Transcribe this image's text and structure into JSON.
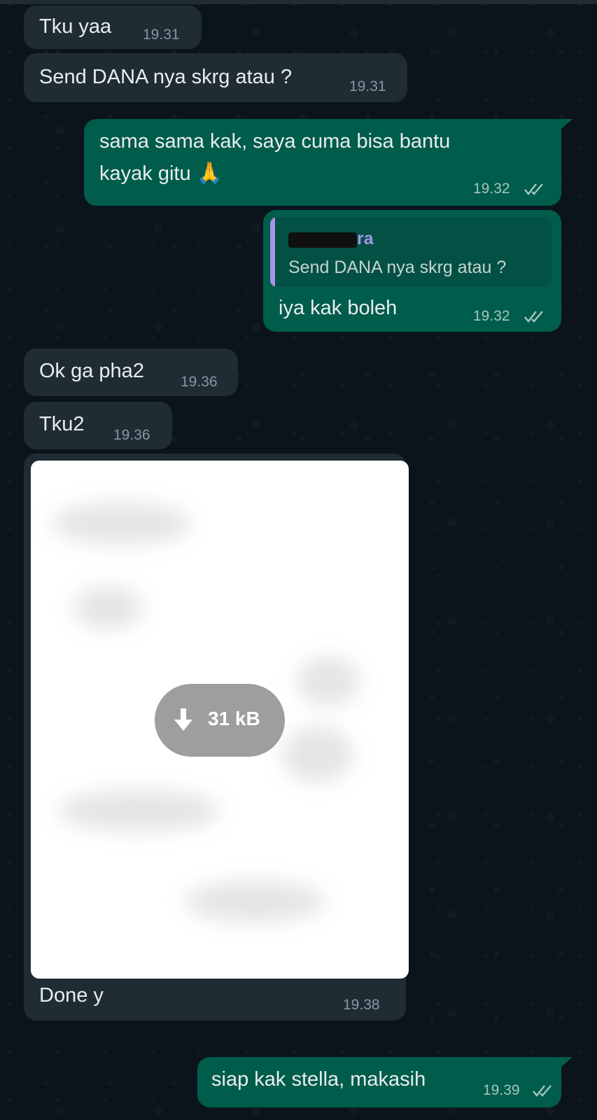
{
  "messages": [
    {
      "text": "Tku yaa",
      "time": "19.31",
      "direction": "incoming"
    },
    {
      "text": "Send DANA nya skrg atau ?",
      "time": "19.31",
      "direction": "incoming"
    },
    {
      "text_line1": "sama sama kak, saya cuma bisa bantu",
      "text_line2": "kayak gitu",
      "emoji": "🙏",
      "time": "19.32",
      "direction": "outgoing",
      "status": "read"
    },
    {
      "quote": {
        "sender_suffix": "ra",
        "text": "Send DANA nya skrg atau ?"
      },
      "text": "iya kak boleh",
      "time": "19.32",
      "direction": "outgoing",
      "status": "read"
    },
    {
      "text": "Ok ga pha2",
      "time": "19.36",
      "direction": "incoming"
    },
    {
      "text": "Tku2",
      "time": "19.36",
      "direction": "incoming"
    },
    {
      "image": {
        "size_label": "31 kB",
        "icon": "download-icon"
      },
      "caption": "Done y",
      "time": "19.38",
      "direction": "incoming"
    },
    {
      "text": "siap kak stella, makasih",
      "time": "19.39",
      "direction": "outgoing",
      "status": "read"
    }
  ],
  "colors": {
    "background": "#0b141a",
    "incoming_bubble": "#202c33",
    "outgoing_bubble": "#005c4b",
    "quote_accent": "#a594e8",
    "timestamp": "#8696a0"
  }
}
